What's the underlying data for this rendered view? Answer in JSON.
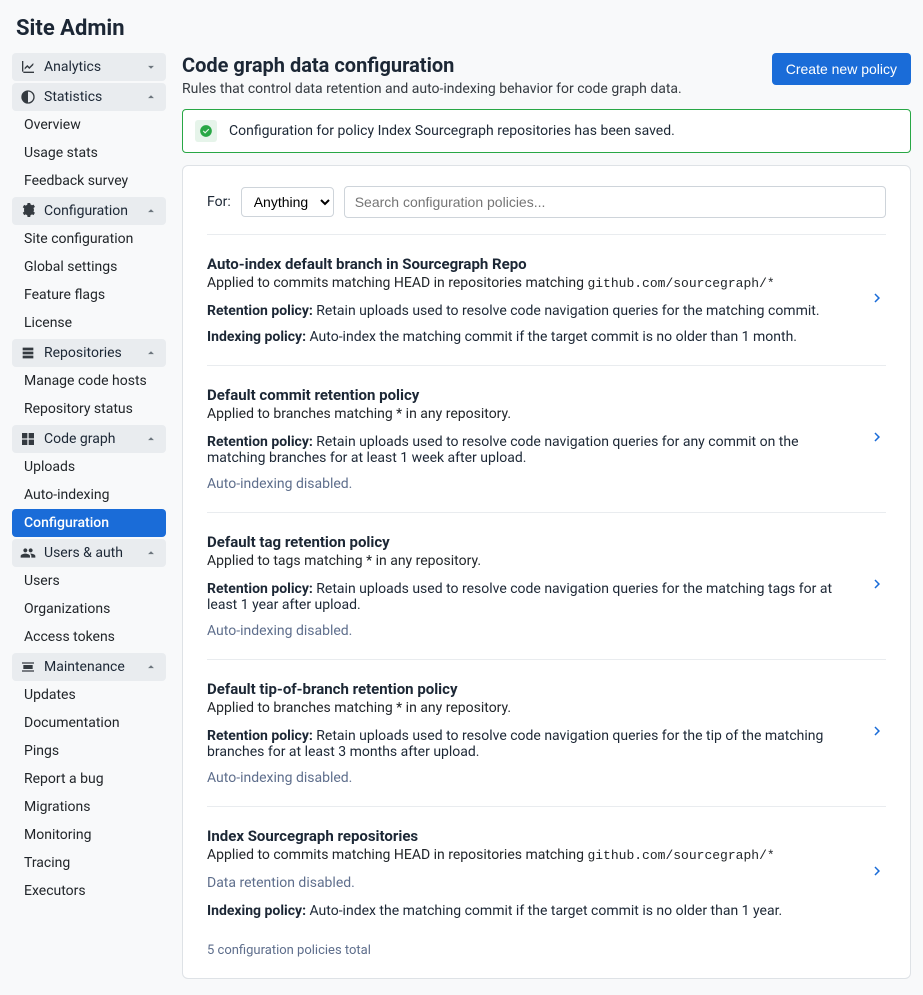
{
  "pageTitle": "Site Admin",
  "sidebar": {
    "sections": [
      {
        "label": "Analytics",
        "items": []
      },
      {
        "label": "Statistics",
        "items": [
          {
            "label": "Overview"
          },
          {
            "label": "Usage stats"
          },
          {
            "label": "Feedback survey"
          }
        ]
      },
      {
        "label": "Configuration",
        "items": [
          {
            "label": "Site configuration"
          },
          {
            "label": "Global settings"
          },
          {
            "label": "Feature flags"
          },
          {
            "label": "License"
          }
        ]
      },
      {
        "label": "Repositories",
        "items": [
          {
            "label": "Manage code hosts"
          },
          {
            "label": "Repository status"
          }
        ]
      },
      {
        "label": "Code graph",
        "items": [
          {
            "label": "Uploads"
          },
          {
            "label": "Auto-indexing"
          },
          {
            "label": "Configuration",
            "active": true
          }
        ]
      },
      {
        "label": "Users & auth",
        "items": [
          {
            "label": "Users"
          },
          {
            "label": "Organizations"
          },
          {
            "label": "Access tokens"
          }
        ]
      },
      {
        "label": "Maintenance",
        "items": [
          {
            "label": "Updates"
          },
          {
            "label": "Documentation"
          },
          {
            "label": "Pings"
          },
          {
            "label": "Report a bug"
          },
          {
            "label": "Migrations"
          },
          {
            "label": "Monitoring"
          },
          {
            "label": "Tracing"
          },
          {
            "label": "Executors"
          }
        ]
      }
    ]
  },
  "main": {
    "heading": "Code graph data configuration",
    "subheading": "Rules that control data retention and auto-indexing behavior for code graph data.",
    "createButton": "Create new policy",
    "alert": "Configuration for policy Index Sourcegraph repositories has been saved.",
    "filter": {
      "label": "For:",
      "selected": "Anything",
      "searchPlaceholder": "Search configuration policies..."
    },
    "policies": [
      {
        "title": "Auto-index default branch in Sourcegraph Repo",
        "appliedPrefix": "Applied to commits matching HEAD in repositories matching ",
        "appliedCode": "github.com/sourcegraph/*",
        "retentionLabel": "Retention policy:",
        "retentionText": " Retain uploads used to resolve code navigation queries for the matching commit.",
        "indexingLabel": "Indexing policy:",
        "indexingText": " Auto-index the matching commit if the target commit is no older than 1 month."
      },
      {
        "title": "Default commit retention policy",
        "appliedPrefix": "Applied to branches matching * in any repository.",
        "appliedCode": "",
        "retentionLabel": "Retention policy:",
        "retentionText": " Retain uploads used to resolve code navigation queries for any commit on the matching branches for at least 1 week after upload.",
        "disabled": "Auto-indexing disabled."
      },
      {
        "title": "Default tag retention policy",
        "appliedPrefix": "Applied to tags matching * in any repository.",
        "appliedCode": "",
        "retentionLabel": "Retention policy:",
        "retentionText": " Retain uploads used to resolve code navigation queries for the matching tags for at least 1 year after upload.",
        "disabled": "Auto-indexing disabled."
      },
      {
        "title": "Default tip-of-branch retention policy",
        "appliedPrefix": "Applied to branches matching * in any repository.",
        "appliedCode": "",
        "retentionLabel": "Retention policy:",
        "retentionText": " Retain uploads used to resolve code navigation queries for the tip of the matching branches for at least 3 months after upload.",
        "disabled": "Auto-indexing disabled."
      },
      {
        "title": "Index Sourcegraph repositories",
        "appliedPrefix": "Applied to commits matching HEAD in repositories matching ",
        "appliedCode": "github.com/sourcegraph/*",
        "disabled": "Data retention disabled.",
        "indexingLabel": "Indexing policy:",
        "indexingText": " Auto-index the matching commit if the target commit is no older than 1 year."
      }
    ],
    "total": "5 configuration policies total"
  }
}
